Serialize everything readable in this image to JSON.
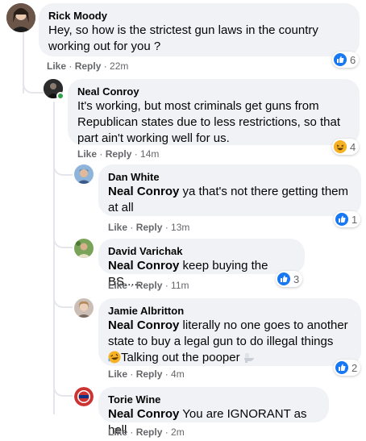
{
  "actions": {
    "like": "Like",
    "reply": "Reply",
    "sep": " · "
  },
  "colors": {
    "bubble": "#f0f2f5",
    "link_blue": "#1877f2",
    "meta_grey": "#65676b",
    "online_green": "#31a24c"
  },
  "comments": [
    {
      "author": "Rick Moody",
      "line1": "Hey, so how is the strictest gun laws in the country",
      "line2": "working out for you ?",
      "time": "22m",
      "reaction": {
        "icon": "like-icon",
        "count": "6"
      }
    },
    {
      "author": "Neal Conroy",
      "line1": "It's working, but most criminals get guns from",
      "line2": "Republican states due to less restrictions, so that",
      "line3": "part ain't working well for us.",
      "time": "14m",
      "reaction": {
        "icon": "haha-icon",
        "count": "4"
      }
    },
    {
      "author": "Dan White",
      "mention": "Neal Conroy",
      "line1": " ya that's not there getting them",
      "line2": "at all",
      "time": "13m",
      "reaction": {
        "icon": "like-icon",
        "count": "1"
      }
    },
    {
      "author": "David Varichak",
      "mention": "Neal Conroy",
      "line1": " keep buying the BS.....",
      "time": "11m",
      "reaction": {
        "icon": "like-icon",
        "count": "3"
      }
    },
    {
      "author": "Jamie Albritton",
      "mention": "Neal Conroy",
      "line1": " literally no one goes to another",
      "line2": "state to buy a legal gun to do illegal things",
      "line3": "Talking out the pooper ",
      "time": "4m",
      "reaction": {
        "icon": "like-icon",
        "count": "2"
      }
    },
    {
      "author": "Torie Wine",
      "mention": "Neal Conroy",
      "line1": " You are IGNORANT as hell",
      "time": "2m"
    }
  ]
}
